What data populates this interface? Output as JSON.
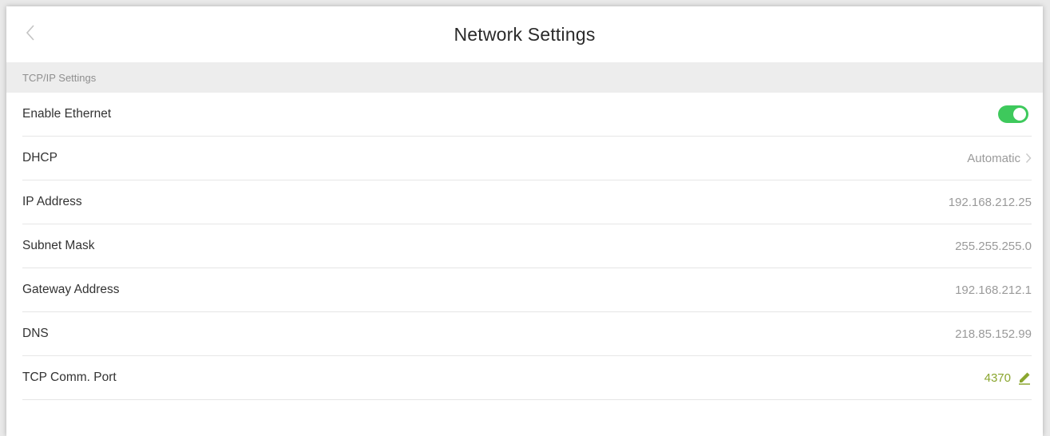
{
  "header": {
    "title": "Network Settings"
  },
  "section": {
    "title": "TCP/IP Settings"
  },
  "rows": {
    "ethernet": {
      "label": "Enable Ethernet",
      "enabled": true
    },
    "dhcp": {
      "label": "DHCP",
      "value": "Automatic"
    },
    "ip": {
      "label": "IP Address",
      "value": "192.168.212.25"
    },
    "subnet": {
      "label": "Subnet Mask",
      "value": "255.255.255.0"
    },
    "gateway": {
      "label": "Gateway Address",
      "value": "192.168.212.1"
    },
    "dns": {
      "label": "DNS",
      "value": "218.85.152.99"
    },
    "port": {
      "label": "TCP Comm. Port",
      "value": "4370"
    }
  },
  "icons": {
    "back": "chevron-left-icon",
    "dhcp_arrow": "chevron-right-icon",
    "port_edit": "pencil-icon"
  },
  "colors": {
    "toggle_on": "#3ec95c",
    "edit_accent": "#8aa62f",
    "section_bg": "#ededed"
  }
}
